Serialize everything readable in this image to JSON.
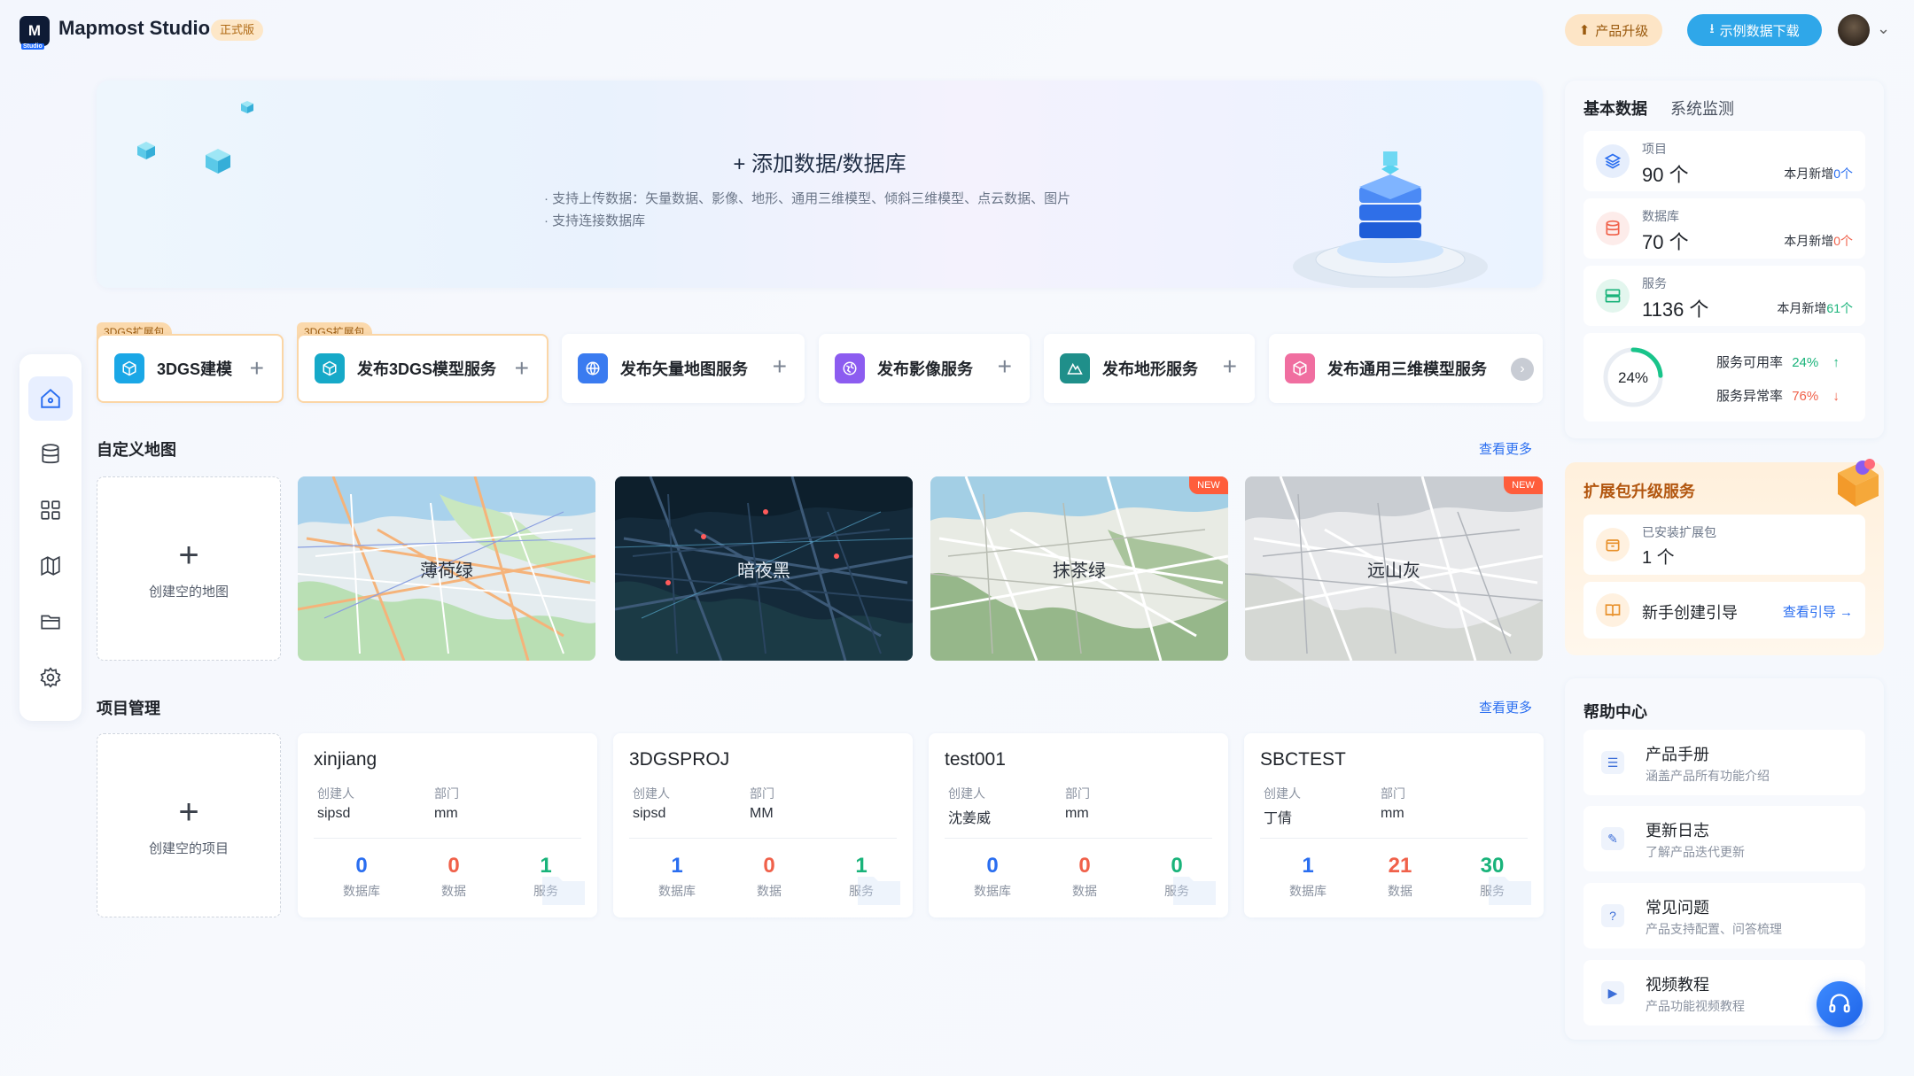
{
  "header": {
    "logo_text": "M",
    "logo_sub": "Studio",
    "app_title": "Mapmost Studio",
    "edition": "正式版",
    "upgrade_label": "产品升级",
    "download_label": "示例数据下载"
  },
  "sidebar": {
    "items": [
      {
        "icon": "home-icon",
        "active": true
      },
      {
        "icon": "database-icon"
      },
      {
        "icon": "grid-icon"
      },
      {
        "icon": "map-icon"
      },
      {
        "icon": "folder-icon"
      },
      {
        "icon": "gear-icon"
      }
    ]
  },
  "banner": {
    "title": "+ 添加数据/数据库",
    "line1": "· 支持上传数据：矢量数据、影像、地形、通用三维模型、倾斜三维模型、点云数据、图片",
    "line2": "· 支持连接数据库"
  },
  "services": [
    {
      "label": "3DGS建模",
      "tag": "3DGS扩展包",
      "color": "#1aa7e6",
      "icon": "cube-icon"
    },
    {
      "label": "发布3DGS模型服务",
      "tag": "3DGS扩展包",
      "color": "#16a9c8",
      "icon": "cube-icon"
    },
    {
      "label": "发布矢量地图服务",
      "tag": "",
      "color": "#3a7bf0",
      "icon": "globe-icon"
    },
    {
      "label": "发布影像服务",
      "tag": "",
      "color": "#8c5cf0",
      "icon": "earth-icon"
    },
    {
      "label": "发布地形服务",
      "tag": "",
      "color": "#1f8f8a",
      "icon": "terrain-icon"
    },
    {
      "label": "发布通用三维模型服务",
      "tag": "",
      "color": "#f06ea0",
      "icon": "box-icon"
    }
  ],
  "custom_maps": {
    "title": "自定义地图",
    "see_more": "查看更多",
    "create_label": "创建空的地图",
    "maps": [
      {
        "name": "薄荷绿",
        "new": false
      },
      {
        "name": "暗夜黑",
        "new": false
      },
      {
        "name": "抹茶绿",
        "new": true
      },
      {
        "name": "远山灰",
        "new": true
      }
    ],
    "new_label": "NEW"
  },
  "projects": {
    "title": "项目管理",
    "see_more": "查看更多",
    "create_label": "创建空的项目",
    "creator_label": "创建人",
    "dept_label": "部门",
    "stat_labels": [
      "数据库",
      "数据",
      "服务"
    ],
    "items": [
      {
        "name": "xinjiang",
        "creator": "sipsd",
        "dept": "mm",
        "stats": [
          "0",
          "0",
          "1"
        ]
      },
      {
        "name": "3DGSPROJ",
        "creator": "sipsd",
        "dept": "MM",
        "stats": [
          "1",
          "0",
          "1"
        ]
      },
      {
        "name": "test001",
        "creator": "沈姜威",
        "dept": "mm",
        "stats": [
          "0",
          "0",
          "0"
        ]
      },
      {
        "name": "SBCTEST",
        "creator": "丁倩",
        "dept": "mm",
        "stats": [
          "1",
          "21",
          "30"
        ]
      }
    ]
  },
  "stats_panel": {
    "tab_active": "基本数据",
    "tab_other": "系统监测",
    "cards": [
      {
        "label": "项目",
        "value": "90 个",
        "new_prefix": "本月新增",
        "new_value": "0个",
        "new_color": "#2a6ef0"
      },
      {
        "label": "数据库",
        "value": "70 个",
        "new_prefix": "本月新增",
        "new_value": "0个",
        "new_color": "#f0614a"
      },
      {
        "label": "服务",
        "value": "1136 个",
        "new_prefix": "本月新增",
        "new_value": "61个",
        "new_color": "#19b37a"
      }
    ],
    "gauge_value": "24%",
    "gauge_fraction": 0.24,
    "available_label": "服务可用率",
    "available_value": "24%",
    "abnormal_label": "服务异常率",
    "abnormal_value": "76%"
  },
  "extension": {
    "title": "扩展包升级服务",
    "installed_label": "已安装扩展包",
    "installed_value": "1 个",
    "guide_label": "新手创建引导",
    "guide_link": "查看引导 →"
  },
  "help": {
    "title": "帮助中心",
    "items": [
      {
        "title": "产品手册",
        "sub": "涵盖产品所有功能介绍"
      },
      {
        "title": "更新日志",
        "sub": "了解产品迭代更新"
      },
      {
        "title": "常见问题",
        "sub": "产品支持配置、问答梳理"
      },
      {
        "title": "视频教程",
        "sub": "产品功能视频教程"
      }
    ]
  }
}
